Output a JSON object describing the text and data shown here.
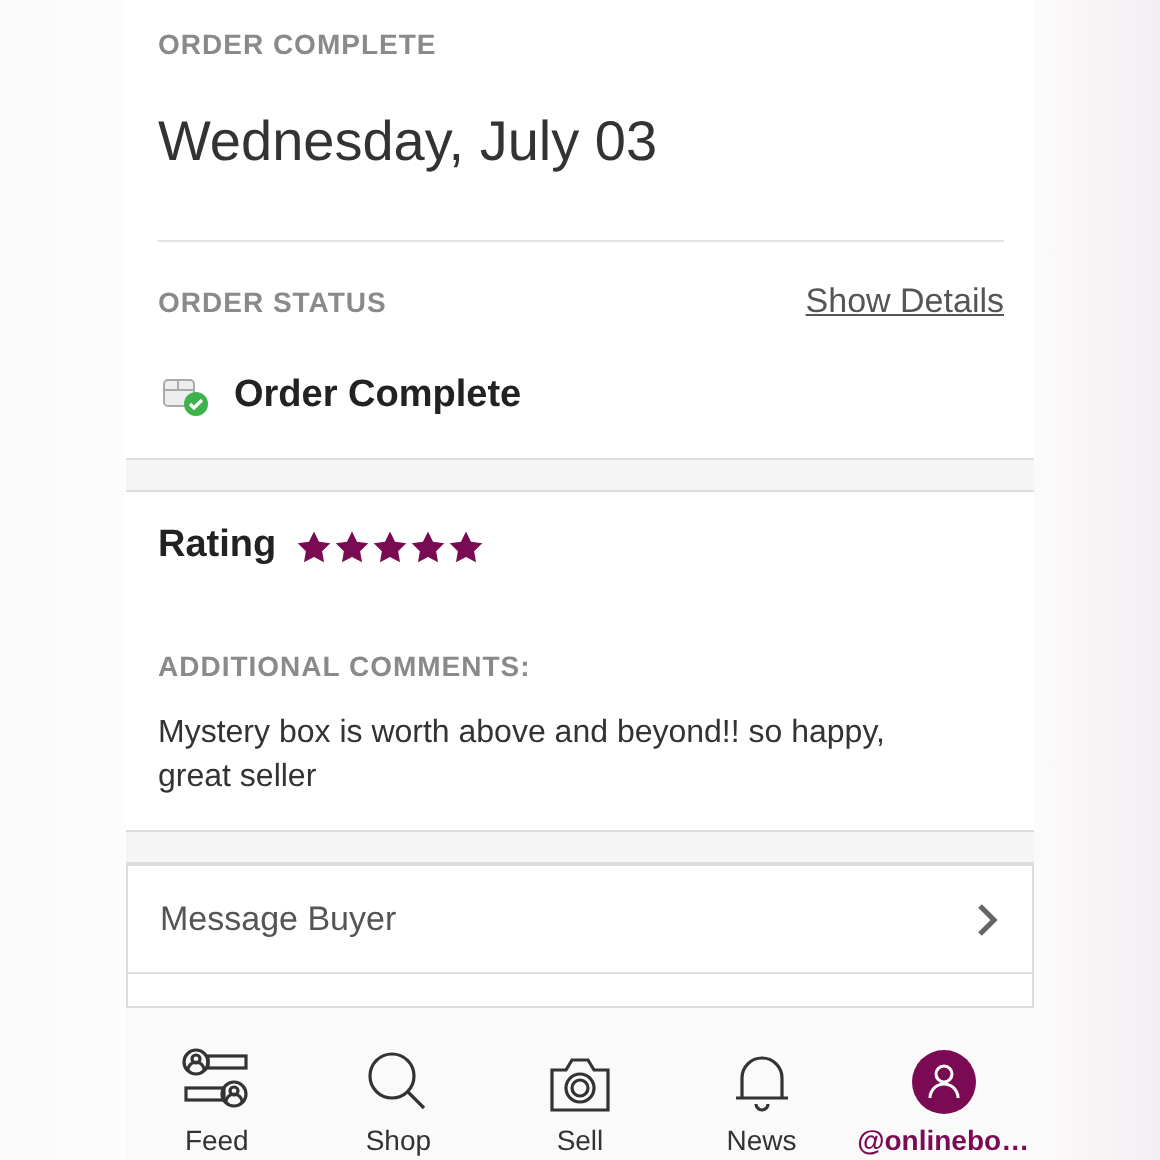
{
  "order": {
    "heading": "ORDER COMPLETE",
    "date": "Wednesday, July 03",
    "status_label": "ORDER STATUS",
    "details_link": "Show Details",
    "status": "Order Complete"
  },
  "rating": {
    "label": "Rating",
    "stars": 5,
    "comments_label": "ADDITIONAL COMMENTS:",
    "comment": "Mystery box is worth above and beyond!! so happy, great seller"
  },
  "message_button": {
    "label": "Message Buyer"
  },
  "tab_bar": [
    {
      "kind": "feed",
      "label": "Feed",
      "selected": false
    },
    {
      "kind": "shop",
      "label": "Shop",
      "selected": false
    },
    {
      "kind": "sell",
      "label": "Sell",
      "selected": false
    },
    {
      "kind": "news",
      "label": "News",
      "selected": false
    },
    {
      "kind": "profile",
      "label": "@onlinebo…",
      "selected": true
    }
  ]
}
